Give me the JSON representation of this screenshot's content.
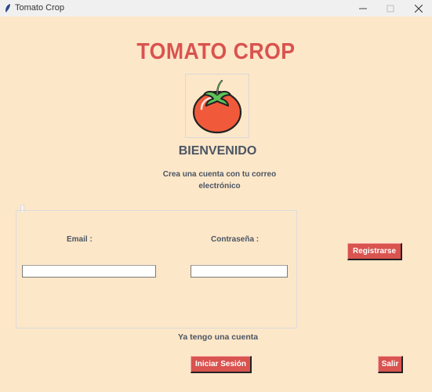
{
  "window": {
    "title": "Tomato Crop",
    "icon": "feather-icon",
    "controls": {
      "minimize": "—",
      "maximize": "☐",
      "close": "✕"
    }
  },
  "header": {
    "title": "TOMATO CROP",
    "logo": "tomato-icon",
    "welcome": "BIENVENIDO",
    "subtitle_line1": "Crea una cuenta con tu correo",
    "subtitle_line2": "electrónico"
  },
  "form": {
    "email_label": "Email :",
    "email_value": "",
    "password_label": "Contraseña :",
    "password_value": ""
  },
  "actions": {
    "register_label": "Registrarse",
    "have_account_text": "Ya tengo una cuenta",
    "login_label": "Iniciar Sesión",
    "exit_label": "Salir"
  },
  "colors": {
    "background": "#fde7c9",
    "accent": "#d9534f",
    "text": "#4a5563"
  }
}
